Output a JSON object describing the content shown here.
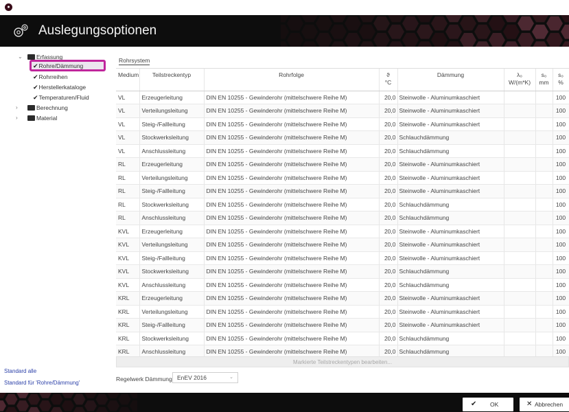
{
  "window": {
    "title": "Auslegungsoptionen"
  },
  "sidebar": {
    "tree": {
      "erfassung": "Erfassung",
      "rohre_daemmung": "Rohre/Dämmung",
      "rohrreihen": "Rohrreihen",
      "herstellerkataloge": "Herstellerkataloge",
      "temperaturen": "Temperaturen/Fluid",
      "berechnung": "Berechnung",
      "material": "Material"
    },
    "links": {
      "standard_alle": "Standard alle",
      "standard_fuer": "Standard für 'Rohre/Dämmung'"
    }
  },
  "main": {
    "group_label": "Rohrsystem",
    "columns": {
      "medium": "Medium",
      "teilstreckentyp": "Teilstreckentyp",
      "rohrfolge": "Rohrfolge",
      "theta": "ϑ",
      "theta_unit": "°C",
      "daemmung": "Dämmung",
      "lambda": "λ₀",
      "lambda_unit": "W/(m*K)",
      "s0": "s₀",
      "s0_unit": "mm",
      "pct": "s₀",
      "pct_unit": "%"
    },
    "rows": [
      [
        "VL",
        "Erzeugerleitung",
        "DIN EN 10255 - Gewinderohr (mittelschwere Reihe M)",
        "20,0",
        "Steinwolle - Aluminumkaschiert",
        "",
        "",
        "100"
      ],
      [
        "VL",
        "Verteilungsleitung",
        "DIN EN 10255 - Gewinderohr (mittelschwere Reihe M)",
        "20,0",
        "Steinwolle - Aluminumkaschiert",
        "",
        "",
        "100"
      ],
      [
        "VL",
        "Steig-/Fallleitung",
        "DIN EN 10255 - Gewinderohr (mittelschwere Reihe M)",
        "20,0",
        "Steinwolle - Aluminumkaschiert",
        "",
        "",
        "100"
      ],
      [
        "VL",
        "Stockwerksleitung",
        "DIN EN 10255 - Gewinderohr (mittelschwere Reihe M)",
        "20,0",
        "Schlauchdämmung",
        "",
        "",
        "100"
      ],
      [
        "VL",
        "Anschlussleitung",
        "DIN EN 10255 - Gewinderohr (mittelschwere Reihe M)",
        "20,0",
        "Schlauchdämmung",
        "",
        "",
        "100"
      ],
      [
        "RL",
        "Erzeugerleitung",
        "DIN EN 10255 - Gewinderohr (mittelschwere Reihe M)",
        "20,0",
        "Steinwolle - Aluminumkaschiert",
        "",
        "",
        "100"
      ],
      [
        "RL",
        "Verteilungsleitung",
        "DIN EN 10255 - Gewinderohr (mittelschwere Reihe M)",
        "20,0",
        "Steinwolle - Aluminumkaschiert",
        "",
        "",
        "100"
      ],
      [
        "RL",
        "Steig-/Fallleitung",
        "DIN EN 10255 - Gewinderohr (mittelschwere Reihe M)",
        "20,0",
        "Steinwolle - Aluminumkaschiert",
        "",
        "",
        "100"
      ],
      [
        "RL",
        "Stockwerksleitung",
        "DIN EN 10255 - Gewinderohr (mittelschwere Reihe M)",
        "20,0",
        "Schlauchdämmung",
        "",
        "",
        "100"
      ],
      [
        "RL",
        "Anschlussleitung",
        "DIN EN 10255 - Gewinderohr (mittelschwere Reihe M)",
        "20,0",
        "Schlauchdämmung",
        "",
        "",
        "100"
      ],
      [
        "KVL",
        "Erzeugerleitung",
        "DIN EN 10255 - Gewinderohr (mittelschwere Reihe M)",
        "20,0",
        "Steinwolle - Aluminumkaschiert",
        "",
        "",
        "100"
      ],
      [
        "KVL",
        "Verteilungsleitung",
        "DIN EN 10255 - Gewinderohr (mittelschwere Reihe M)",
        "20,0",
        "Steinwolle - Aluminumkaschiert",
        "",
        "",
        "100"
      ],
      [
        "KVL",
        "Steig-/Fallleitung",
        "DIN EN 10255 - Gewinderohr (mittelschwere Reihe M)",
        "20,0",
        "Steinwolle - Aluminumkaschiert",
        "",
        "",
        "100"
      ],
      [
        "KVL",
        "Stockwerksleitung",
        "DIN EN 10255 - Gewinderohr (mittelschwere Reihe M)",
        "20,0",
        "Schlauchdämmung",
        "",
        "",
        "100"
      ],
      [
        "KVL",
        "Anschlussleitung",
        "DIN EN 10255 - Gewinderohr (mittelschwere Reihe M)",
        "20,0",
        "Schlauchdämmung",
        "",
        "",
        "100"
      ],
      [
        "KRL",
        "Erzeugerleitung",
        "DIN EN 10255 - Gewinderohr (mittelschwere Reihe M)",
        "20,0",
        "Steinwolle - Aluminumkaschiert",
        "",
        "",
        "100"
      ],
      [
        "KRL",
        "Verteilungsleitung",
        "DIN EN 10255 - Gewinderohr (mittelschwere Reihe M)",
        "20,0",
        "Steinwolle - Aluminumkaschiert",
        "",
        "",
        "100"
      ],
      [
        "KRL",
        "Steig-/Fallleitung",
        "DIN EN 10255 - Gewinderohr (mittelschwere Reihe M)",
        "20,0",
        "Steinwolle - Aluminumkaschiert",
        "",
        "",
        "100"
      ],
      [
        "KRL",
        "Stockwerksleitung",
        "DIN EN 10255 - Gewinderohr (mittelschwere Reihe M)",
        "20,0",
        "Schlauchdämmung",
        "",
        "",
        "100"
      ],
      [
        "KRL",
        "Anschlussleitung",
        "DIN EN 10255 - Gewinderohr (mittelschwere Reihe M)",
        "20,0",
        "Schlauchdämmung",
        "",
        "",
        "100"
      ]
    ],
    "edit_button": "Markierte Teilstreckentypen bearbeiten...",
    "regelwerk_label": "Regelwerk Dämmung:",
    "regelwerk_value": "EnEV 2016"
  },
  "footer": {
    "ok": "OK",
    "cancel": "Abbrechen"
  },
  "colors": {
    "header_bg": "#0d0d0d",
    "selection_border": "#c0269c",
    "link": "#2a3fa8",
    "hex_accent": "#6b1d3c"
  },
  "icons": [
    "app-icon",
    "gear-icon",
    "folder-icon",
    "check-icon",
    "chevron-icon",
    "x-icon"
  ]
}
